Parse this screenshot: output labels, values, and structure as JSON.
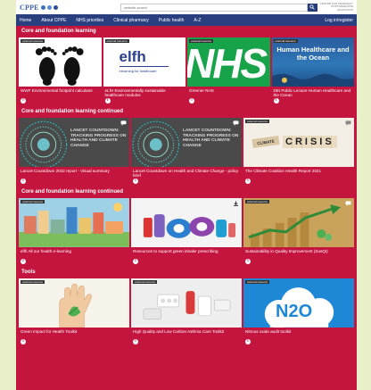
{
  "header": {
    "logo_text": "CPPE",
    "search_placeholder": "website search",
    "centre_line1": "CENTRE FOR PHARMACY",
    "centre_line2": "POSTGRADUATE EDUCATION"
  },
  "nav": {
    "items": [
      "Home",
      "About CPPE",
      "NHS priorities",
      "Clinical pharmacy",
      "Public health",
      "A-Z"
    ],
    "login": "Log in/register"
  },
  "colors": {
    "main_bg": "#c4153f",
    "nav_bg": "#2a3f7f",
    "page_bg": "#e8efc9"
  },
  "sections": [
    {
      "title": "Core and foundation learning",
      "cards": [
        {
          "badge": "external resource",
          "title": "WWF Environmental footprint calculator",
          "icon": "footprints-icon"
        },
        {
          "badge": "external resource",
          "title": "eLfH Environmentally sustainable healthcare modules",
          "icon": "elfh-logo",
          "thumb_text": "elfh",
          "thumb_sub": "elearning for healthcare"
        },
        {
          "badge": "external resource",
          "title": "Greener NHS",
          "icon": "nhs-logo",
          "thumb_text": "NHS"
        },
        {
          "badge": "external resource",
          "title": "DEI Public Lecture Human Healthcare and the Ocean",
          "icon": "ocean-icon",
          "thumb_text": "Human Healthcare and the Ocean"
        }
      ]
    },
    {
      "title": "Core and foundation learning continued",
      "cards": [
        {
          "badge": "",
          "title": "Lancet Countdown 2022 report - Visual summary",
          "icon": "lancet-icon",
          "thumb_text": "LANCET COUNTDOWN: TRACKING PROGRESS ON HEALTH AND CLIMATE CHANGE"
        },
        {
          "badge": "",
          "title": "Lancet Countdown on Health and Climate Change - policy brief",
          "icon": "lancet-icon",
          "thumb_text": "LANCET COUNTDOWN: TRACKING PROGRESS ON HEALTH AND CLIMATE CHANGE"
        },
        {
          "badge": "external resource",
          "title": "The Climate Coalition Health Report 2021",
          "icon": "crisis-icon",
          "thumb_text": "CRISIS",
          "thumb_sub": "CLIMATE"
        }
      ]
    },
    {
      "title": "Core and foundation learning continued",
      "cards": [
        {
          "badge": "external resource",
          "title": "elfh All our health e-learning",
          "icon": "town-icon"
        },
        {
          "badge": "",
          "title": "Resources to support green inhaler prescribing",
          "icon": "inhaler-icon"
        },
        {
          "badge": "external resource",
          "title": "Sustainability in Quality Improvement (SusQI)",
          "icon": "growth-icon"
        }
      ]
    },
    {
      "title": "Tools",
      "cards": [
        {
          "badge": "external resource",
          "title": "Green Impact for Health Toolkit",
          "icon": "hand-leaf-icon"
        },
        {
          "badge": "external resource",
          "title": "High Quality and Low Carbon Asthma Care Toolkit",
          "icon": "medicine-icon"
        },
        {
          "badge": "external resource",
          "title": "Nitrous oxide audit toolkit",
          "icon": "n2o-icon",
          "thumb_text": "N2O"
        }
      ]
    }
  ]
}
